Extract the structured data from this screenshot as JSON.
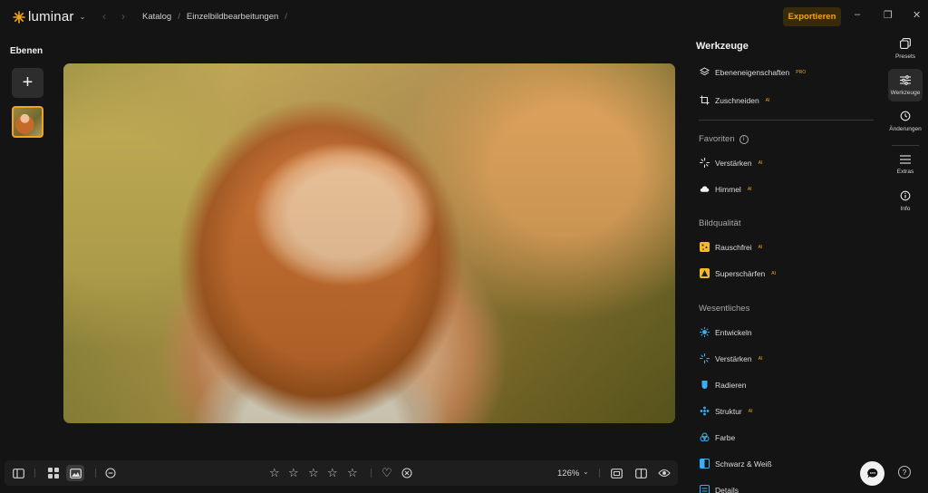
{
  "app": {
    "logo_text": "luminar",
    "accent": "#f3a51c"
  },
  "breadcrumb": {
    "items": [
      "Katalog",
      "Einzelbildbearbeitungen"
    ],
    "separator": "/"
  },
  "header": {
    "export_label": "Exportieren"
  },
  "layers": {
    "title": "Ebenen",
    "add_label": "+"
  },
  "tools": {
    "title": "Werkzeuge",
    "top_items": [
      {
        "label": "Ebeneneigenschaften",
        "badge": "PRO",
        "icon": "layers-icon"
      },
      {
        "label": "Zuschneiden",
        "badge": "AI",
        "icon": "crop-icon"
      }
    ],
    "sections": [
      {
        "title": "Favoriten",
        "items": [
          {
            "label": "Verstärken",
            "badge": "AI",
            "icon": "sparkle-icon"
          },
          {
            "label": "Himmel",
            "badge": "AI",
            "icon": "cloud-icon"
          }
        ]
      },
      {
        "title": "Bildqualität",
        "items": [
          {
            "label": "Rauschfrei",
            "badge": "AI",
            "icon": "noise-icon"
          },
          {
            "label": "Superschärfen",
            "badge": "AI",
            "icon": "sharpen-icon"
          }
        ]
      },
      {
        "title": "Wesentliches",
        "items": [
          {
            "label": "Entwickeln",
            "badge": "",
            "icon": "sun-icon"
          },
          {
            "label": "Verstärken",
            "badge": "AI",
            "icon": "sparkle-icon"
          },
          {
            "label": "Radieren",
            "badge": "",
            "icon": "eraser-icon"
          },
          {
            "label": "Struktur",
            "badge": "AI",
            "icon": "structure-icon"
          },
          {
            "label": "Farbe",
            "badge": "",
            "icon": "color-icon"
          },
          {
            "label": "Schwarz & Weiß",
            "badge": "",
            "icon": "bw-icon"
          },
          {
            "label": "Details",
            "badge": "",
            "icon": "details-icon"
          }
        ]
      }
    ]
  },
  "rail": {
    "items": [
      {
        "label": "Presets",
        "icon": "presets-icon"
      },
      {
        "label": "Werkzeuge",
        "icon": "sliders-icon"
      },
      {
        "label": "Änderungen",
        "icon": "history-icon"
      },
      {
        "label": "Extras",
        "icon": "list-icon"
      },
      {
        "label": "Info",
        "icon": "info-icon"
      }
    ]
  },
  "bottom": {
    "zoom": "126%",
    "rating_max": 5
  }
}
